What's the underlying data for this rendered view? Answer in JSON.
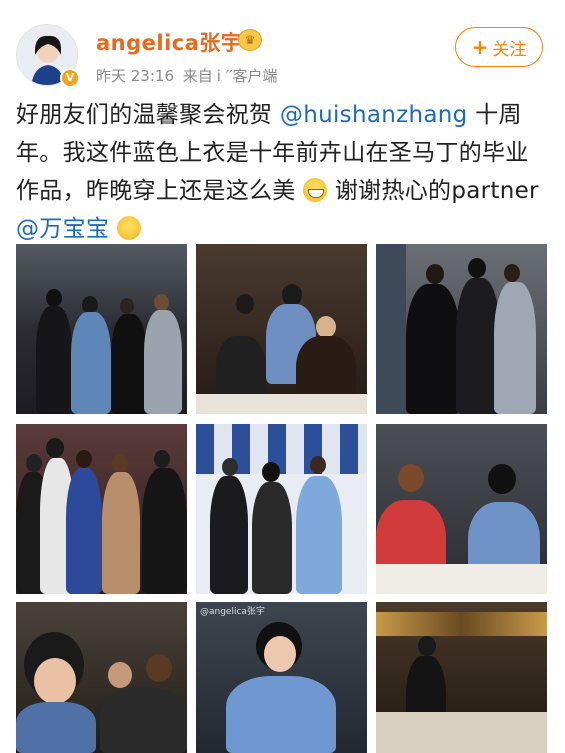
{
  "header": {
    "username": "angelica张宇",
    "time": "昨天 23:16",
    "source_prefix": "来自",
    "source_app": "i    ′′客户端",
    "follow_label": "关注",
    "avatar_icon": "user-avatar-icon",
    "verified_icon": "verified-v-badge-icon",
    "member_icon": "crown-icon",
    "accent_color": "#ff8200",
    "username_color": "#e96a1c"
  },
  "post": {
    "line1_text": "好朋友们的温馨聚会祝贺 ",
    "mention1": "@huishanzhang",
    "line1_after": " 十周年。我这件蓝色上衣是十年前卉山在圣马丁的毕业作品，昨晚穿上还是这么美",
    "after_emoji": " 谢谢热心的partner ",
    "mention2": "@万宝宝",
    "mention_color": "#1a6bbf"
  },
  "photos": {
    "watermark": "@angelica张宇",
    "items": [
      {
        "label": "group-photo-5-people"
      },
      {
        "label": "dinner-table-group"
      },
      {
        "label": "three-friends-standing"
      },
      {
        "label": "party-group-photo"
      },
      {
        "label": "group-blue-white-wall"
      },
      {
        "label": "two-women-at-table"
      },
      {
        "label": "selfie-group"
      },
      {
        "label": "portrait-blue-jacket"
      },
      {
        "label": "restaurant-speech"
      }
    ]
  }
}
